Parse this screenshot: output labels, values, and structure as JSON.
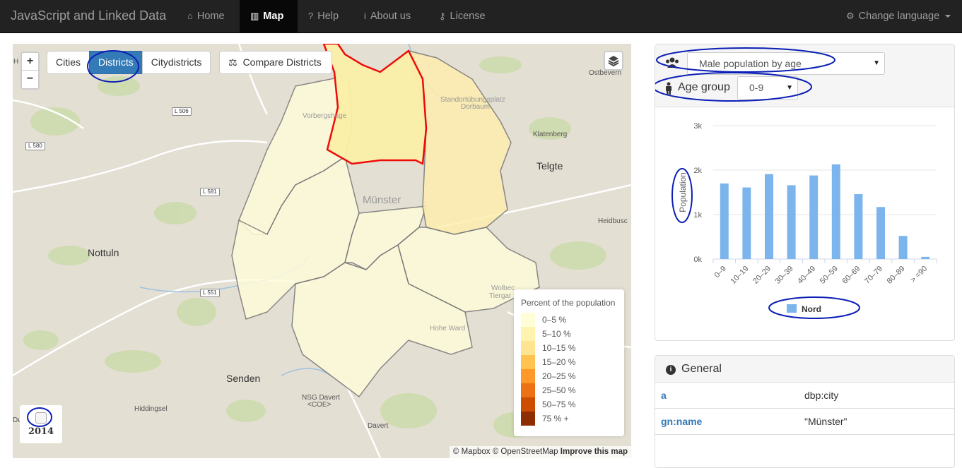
{
  "nav": {
    "brand": "JavaScript and Linked Data",
    "items": [
      {
        "label": "Home",
        "icon": "home-icon",
        "glyph": "⌂"
      },
      {
        "label": "Map",
        "icon": "map-icon",
        "glyph": "▥"
      },
      {
        "label": "Help",
        "icon": "help-icon",
        "glyph": "?"
      },
      {
        "label": "About us",
        "icon": "info-icon",
        "glyph": "i"
      },
      {
        "label": "License",
        "icon": "key-icon",
        "glyph": "⚷"
      }
    ],
    "language": {
      "label": "Change language",
      "icon": "gears-icon",
      "glyph": "⚙"
    }
  },
  "map": {
    "zoom_in": "+",
    "zoom_out": "−",
    "modes": [
      "Cities",
      "Districts",
      "Citydistricts"
    ],
    "active_mode": "Districts",
    "compare": {
      "label": "Compare Districts",
      "icon": "balance-scale-icon",
      "glyph": "⚖"
    },
    "place_labels": {
      "nottuln": "Nottuln",
      "senden": "Senden",
      "telgte": "Telgte",
      "muenster": "Münster",
      "ostbevern": "Ostbevern",
      "klatenberg": "Klatenberg",
      "hiddingsel": "Hiddingsel",
      "davert": "Davert",
      "nsg": "NSG Davert",
      "coe": "<COE>",
      "heidbusch": "Heidbusc",
      "vorbergshuegel": "Vorbergshüge",
      "standort1": "Standortübungsplatz",
      "standort2": "Dorbaum",
      "wolbeck1": "Wolbec",
      "wolbeck2": "Tiergar",
      "hohe_ward": "Hohe Ward",
      "h": "H",
      "du": "Du"
    },
    "road_labels": {
      "l506": "L 506",
      "l580": "L 580",
      "l581": "L 581",
      "l551": "L 551"
    },
    "legend": {
      "title": "Percent of the population",
      "rows": [
        {
          "label": "0–5 %",
          "color": "#fffed9"
        },
        {
          "label": "5–10 %",
          "color": "#fff3b0"
        },
        {
          "label": "10–15 %",
          "color": "#fee391"
        },
        {
          "label": "15–20 %",
          "color": "#fec44f"
        },
        {
          "label": "20–25 %",
          "color": "#fe9929"
        },
        {
          "label": "25–50 %",
          "color": "#ec7014"
        },
        {
          "label": "50–75 %",
          "color": "#cc4c02"
        },
        {
          "label": "75 % +",
          "color": "#8c2d04"
        }
      ]
    },
    "year": "2014",
    "attribution": {
      "mapbox": "© Mapbox",
      "osm": "© OpenStreetMap",
      "improve": "Improve this map"
    }
  },
  "stats_panel": {
    "dataset_icon": "users-icon",
    "dataset_select": "Male population by age",
    "age_icon": "person-icon",
    "age_group_label": "Age group",
    "age_group_select": "0-9"
  },
  "chart_data": {
    "type": "bar",
    "categories": [
      "0–9",
      "10–19",
      "20–29",
      "30–39",
      "40–49",
      "50–59",
      "60–69",
      "70–79",
      "80–89",
      "> =90"
    ],
    "series": [
      {
        "name": "Nord",
        "values": [
          1700,
          1610,
          1910,
          1660,
          1880,
          2130,
          1460,
          1170,
          520,
          50
        ],
        "color": "#7cb5ec"
      }
    ],
    "ylabel": "Population",
    "ylim": [
      0,
      3000
    ],
    "yticks": [
      0,
      1000,
      2000,
      3000
    ],
    "yticklabels": [
      "0k",
      "1k",
      "2k",
      "3k"
    ],
    "grid": true,
    "legend": "bottom-center"
  },
  "general_panel": {
    "title": "General",
    "icon": "info-icon",
    "rows": [
      {
        "key": "a",
        "value": "dbp:city"
      },
      {
        "key": "gn:name",
        "value": "\"Münster\""
      }
    ]
  }
}
